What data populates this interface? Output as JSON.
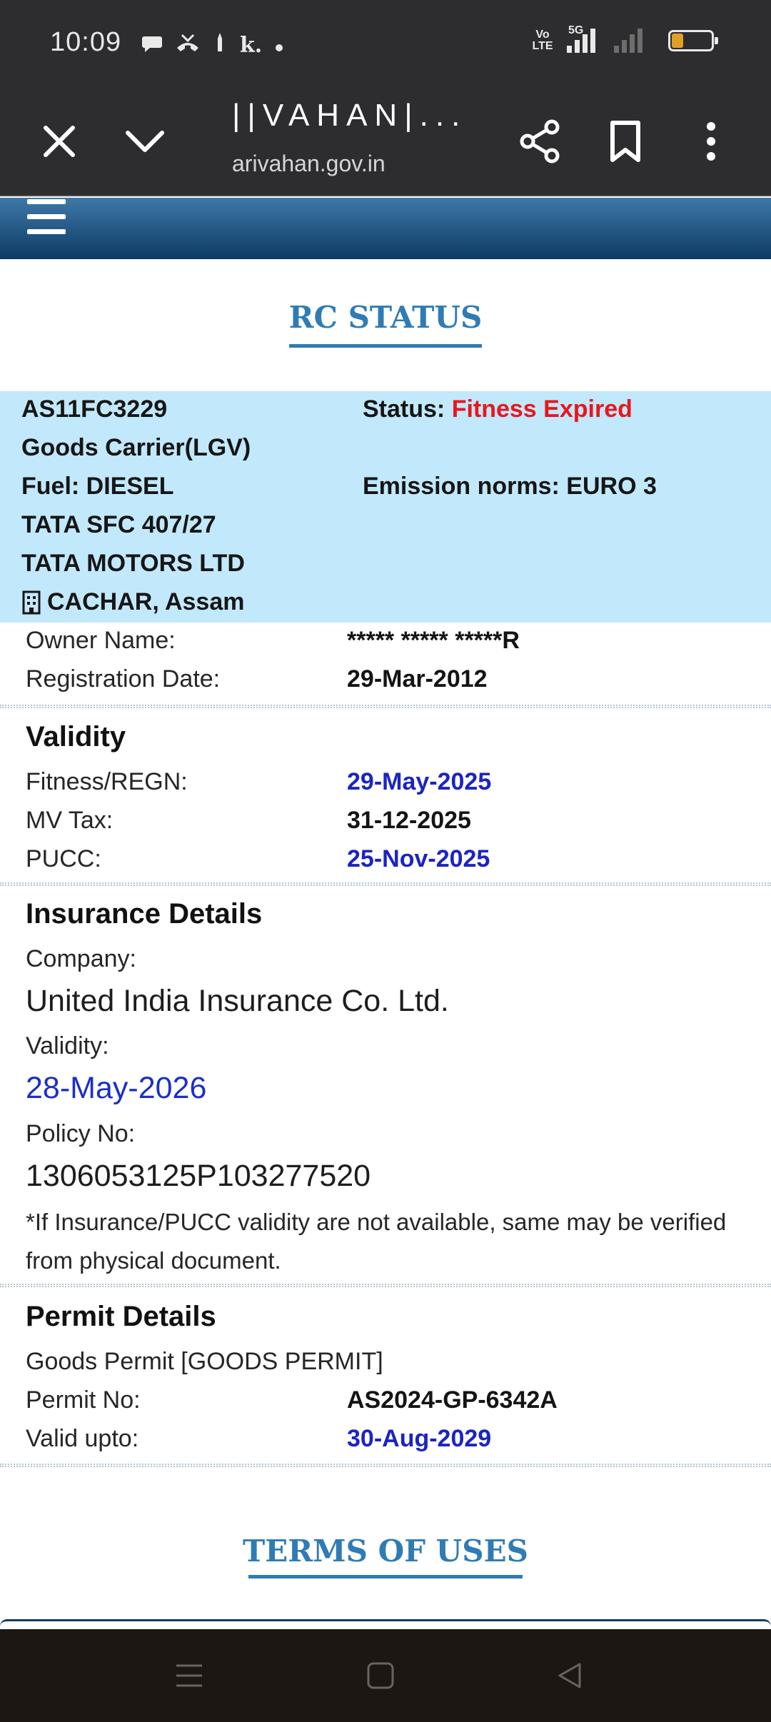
{
  "status_bar": {
    "time": "10:09",
    "volte": "Vo LTE",
    "network": "5G",
    "battery": "29",
    "battery_level": 0.29
  },
  "browser": {
    "title": "||VAHAN|...",
    "url": "arivahan.gov.in"
  },
  "page": {
    "heading": "RC STATUS",
    "vehicle": {
      "reg_no": "AS11FC3229",
      "class": "Goods Carrier(LGV)",
      "fuel": "Fuel: DIESEL",
      "model": "TATA SFC 407/27",
      "maker": "TATA MOTORS LTD",
      "rto": "CACHAR, Assam",
      "status_label": "Status: ",
      "status_value": "Fitness Expired",
      "emission": "Emission norms: EURO 3"
    },
    "owner": {
      "name_label": "Owner Name:",
      "name_value": "***** ***** *****R",
      "reg_date_label": "Registration Date:",
      "reg_date_value": "29-Mar-2012"
    },
    "validity": {
      "title": "Validity",
      "fitness_label": "Fitness/REGN:",
      "fitness_value": "29-May-2025",
      "tax_label": "MV Tax:",
      "tax_value": "31-12-2025",
      "pucc_label": "PUCC:",
      "pucc_value": "25-Nov-2025"
    },
    "insurance": {
      "title": "Insurance Details",
      "company_label": "Company:",
      "company_value": "United India Insurance Co. Ltd.",
      "validity_label": "Validity:",
      "validity_value": "28-May-2026",
      "policy_label": "Policy No:",
      "policy_value": "1306053125P103277520",
      "note": "*If Insurance/PUCC validity are not available, same may be verified from physical document."
    },
    "permit": {
      "title": "Permit Details",
      "type": "Goods Permit [GOODS PERMIT]",
      "no_label": "Permit No:",
      "no_value": "AS2024-GP-6342A",
      "valid_label": "Valid upto:",
      "valid_value": "30-Aug-2029"
    },
    "terms": "TERMS OF USES"
  },
  "colors": {
    "accent_blue": "#2f7bb5",
    "panel_bg": "#c2e8fb",
    "status_red": "#e8171d",
    "date_blue": "#1b24c2"
  }
}
